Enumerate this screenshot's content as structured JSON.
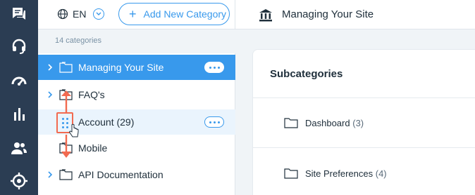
{
  "rail": {
    "icons": [
      "chat-icon",
      "headset-icon",
      "gauge-icon",
      "bar-chart-icon",
      "users-icon",
      "target-icon"
    ],
    "color": "#2b3d53"
  },
  "category_panel": {
    "language": "EN",
    "add_button_label": "Add New Category",
    "count_label": "14 categories",
    "categories": [
      {
        "label": "Managing Your Site",
        "state": "selected",
        "expandable": true,
        "menu": true
      },
      {
        "label": "FAQ's",
        "state": "normal",
        "expandable": true,
        "menu": false
      },
      {
        "label": "Account (29)",
        "state": "dragging",
        "expandable": false,
        "menu": true
      },
      {
        "label": "Mobile",
        "state": "normal",
        "expandable": false,
        "menu": false
      },
      {
        "label": "API Documentation",
        "state": "normal",
        "expandable": true,
        "menu": false
      }
    ]
  },
  "main": {
    "title": "Managing Your Site",
    "card_title": "Subcategories",
    "subcategories": [
      {
        "name": "Dashboard",
        "count": "(3)"
      },
      {
        "name": "Site Preferences",
        "count": "(4)"
      }
    ]
  },
  "colors": {
    "accent": "#3899ec",
    "drag_highlight": "#f26a50"
  }
}
